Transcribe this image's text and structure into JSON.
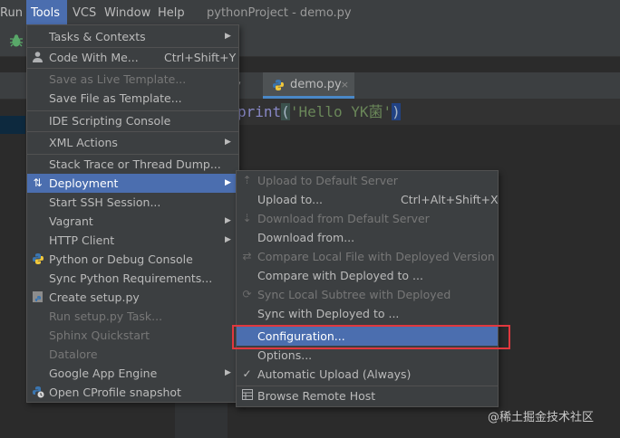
{
  "menubar": {
    "items": [
      "Run",
      "Tools",
      "VCS",
      "Window",
      "Help"
    ],
    "active": "Tools",
    "title": "pythonProject - demo.py"
  },
  "editor": {
    "tab_partial": "y",
    "tab_active": "demo.py",
    "tab_close": "×",
    "code": {
      "fn": "print",
      "open": "(",
      "str": "'Hello YK菌'",
      "close": ")"
    }
  },
  "tools_menu": {
    "items": [
      {
        "label": "Tasks & Contexts",
        "submenu": true
      },
      {
        "label": "Code With Me...",
        "shortcut": "Ctrl+Shift+Y",
        "icon": "person-icon"
      },
      {
        "label": "Save as Live Template...",
        "disabled": true
      },
      {
        "label": "Save File as Template..."
      },
      {
        "label": "IDE Scripting Console"
      },
      {
        "label": "XML Actions",
        "submenu": true
      },
      {
        "label": "Stack Trace or Thread Dump..."
      },
      {
        "label": "Deployment",
        "submenu": true,
        "selected": true,
        "icon": "deployment-icon"
      },
      {
        "label": "Start SSH Session..."
      },
      {
        "label": "Vagrant",
        "submenu": true
      },
      {
        "label": "HTTP Client",
        "submenu": true
      },
      {
        "label": "Python or Debug Console",
        "icon": "python-icon"
      },
      {
        "label": "Sync Python Requirements..."
      },
      {
        "label": "Create setup.py",
        "icon": "python-file-icon"
      },
      {
        "label": "Run setup.py Task...",
        "disabled": true
      },
      {
        "label": "Sphinx Quickstart",
        "disabled": true
      },
      {
        "label": "Datalore",
        "disabled": true
      },
      {
        "label": "Google App Engine",
        "submenu": true
      },
      {
        "label": "Open CProfile snapshot",
        "icon": "profile-icon"
      }
    ]
  },
  "deployment_menu": {
    "items": [
      {
        "label": "Upload to Default Server",
        "disabled": true,
        "icon": "upload-icon"
      },
      {
        "label": "Upload to...",
        "shortcut": "Ctrl+Alt+Shift+X"
      },
      {
        "label": "Download from Default Server",
        "disabled": true,
        "icon": "download-icon"
      },
      {
        "label": "Download from..."
      },
      {
        "label": "Compare Local File with Deployed Version",
        "disabled": true,
        "icon": "compare-icon"
      },
      {
        "label": "Compare with Deployed to ..."
      },
      {
        "label": "Sync Local Subtree with Deployed",
        "disabled": true,
        "icon": "sync-icon"
      },
      {
        "label": "Sync with Deployed to ..."
      },
      {
        "label": "Configuration...",
        "selected": true
      },
      {
        "label": "Options..."
      },
      {
        "label": "Automatic Upload (Always)",
        "checked": true
      },
      {
        "label": "Browse Remote Host",
        "icon": "remote-host-icon"
      }
    ]
  },
  "colors": {
    "menu_bg": "#3c3f41",
    "selection": "#4b6eaf",
    "callout": "#e0383e"
  },
  "watermark": "@稀土掘金技术社区"
}
